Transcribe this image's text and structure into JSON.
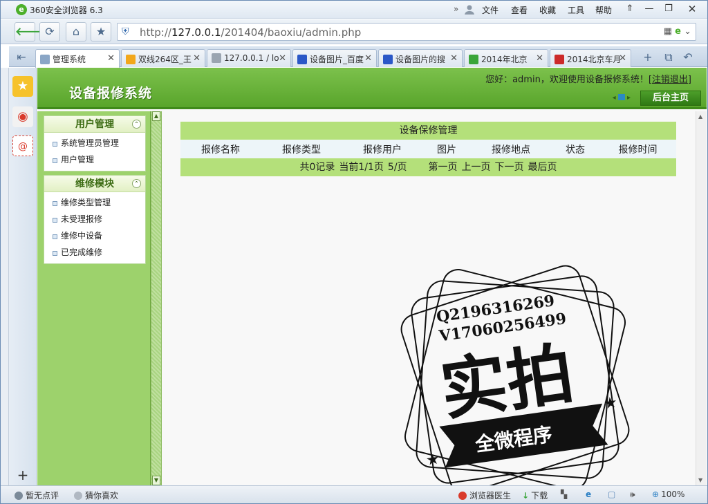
{
  "browser": {
    "title": "360安全浏览器 6.3",
    "logo": "e",
    "menu": [
      "文件",
      "查看",
      "收藏",
      "工具",
      "帮助"
    ],
    "url_prefix": "http://",
    "url_host": "127.0.0.1",
    "url_path": "/201404/baoxiu/admin.php",
    "tabs": [
      {
        "label": "管理系统",
        "icon_color": "#8aa6c6",
        "active": true
      },
      {
        "label": "双线264区_王",
        "icon_color": "#f2a71b",
        "active": false
      },
      {
        "label": "127.0.0.1 / lo",
        "icon_color": "#9aa5b1",
        "active": false
      },
      {
        "label": "设备图片_百度",
        "icon_color": "#2b58c7",
        "active": false
      },
      {
        "label": "设备图片的搜",
        "icon_color": "#2b58c7",
        "active": false
      },
      {
        "label": "2014年北京",
        "icon_color": "#3aa53a",
        "active": false
      },
      {
        "label": "2014北京车月",
        "icon_color": "#cc2a2a",
        "active": false
      }
    ]
  },
  "app": {
    "title": "设备报修系统",
    "welcome": "您好：admin，欢迎使用设备报修系统！[",
    "logout": "注销退出",
    "welcome_end": "]",
    "home_button": "后台主页"
  },
  "menu": {
    "sections": [
      {
        "title": "用户管理",
        "items": [
          "系统管理员管理",
          "用户管理"
        ]
      },
      {
        "title": "维修模块",
        "items": [
          "维修类型管理",
          "未受理报修",
          "维修中设备",
          "已完成维修"
        ]
      }
    ]
  },
  "grid": {
    "title": "设备保修管理",
    "columns": [
      "报修名称",
      "报修类型",
      "报修用户",
      "图片",
      "报修地点",
      "状态",
      "报修时间"
    ],
    "footer": [
      "共0记录",
      "当前1/1页",
      "5/页",
      "第一页",
      "上一页",
      "下一页",
      "最后页"
    ]
  },
  "watermark": {
    "line1": "Q2196316269",
    "line2": "V17060256499",
    "main": "实拍",
    "ribbon": "全微程序"
  },
  "statusbar": {
    "left1": "暂无点评",
    "left2": "猜你喜欢",
    "right1": "浏览器医生",
    "right2": "下载",
    "zoom": "100%"
  }
}
